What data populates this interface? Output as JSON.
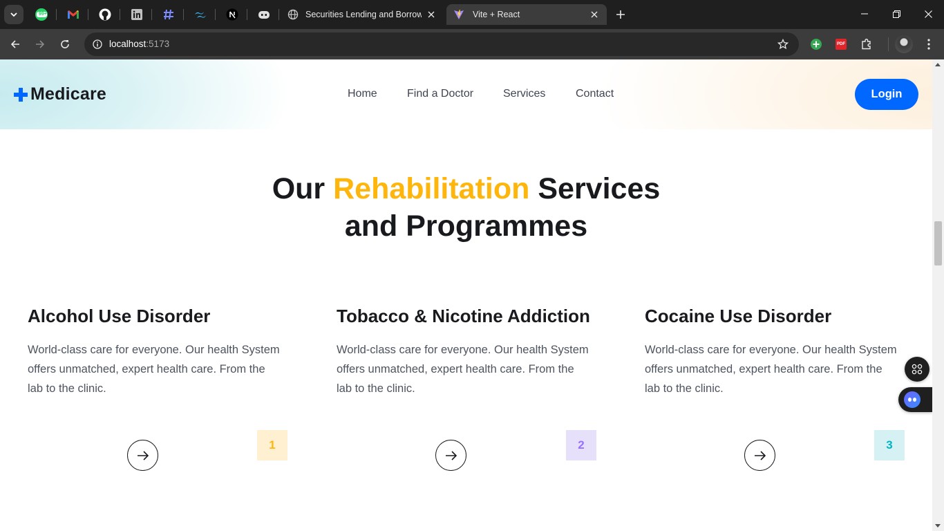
{
  "browser": {
    "tabs": [
      {
        "title": "Securities Lending and Borrowing",
        "active": false
      },
      {
        "title": "Vite + React",
        "active": true
      }
    ],
    "pinned_badge": "99+",
    "pinned_tabs": [
      "whatsapp-icon",
      "gmail-icon",
      "github-icon",
      "linkedin-icon",
      "hashnode-icon",
      "tailwind-icon",
      "nextjs-icon",
      "copilot-icon"
    ],
    "url_host": "localhost",
    "url_port": ":5173",
    "extensions": [
      "add-extension-icon",
      "pdf-extension-icon",
      "puzzle-icon",
      "profile-avatar",
      "menu-icon"
    ],
    "pdf_label": "PDF"
  },
  "site": {
    "logo": "Medicare",
    "nav": [
      "Home",
      "Find a Doctor",
      "Services",
      "Contact"
    ],
    "login": "Login",
    "heading": {
      "before": "Our ",
      "highlight": "Rehabilitation",
      "after_line1": " Services",
      "line2": "and Programmes"
    },
    "cards": [
      {
        "title": "Alcohol Use Disorder",
        "description": "World-class care for everyone. Our health System offers unmatched, expert health care. From the lab to the clinic.",
        "number": "1",
        "badge_bg": "#fef0d0",
        "badge_fg": "#feb60d"
      },
      {
        "title": "Tobacco & Nicotine Addiction",
        "description": "World-class care for everyone. Our health System offers unmatched, expert health care. From the lab to the clinic.",
        "number": "2",
        "badge_bg": "#e6e0fb",
        "badge_fg": "#9771ff"
      },
      {
        "title": "Cocaine Use Disorder",
        "description": "World-class care for everyone. Our health System offers unmatched, expert health care. From the lab to the clinic.",
        "number": "3",
        "badge_bg": "#d5f1f4",
        "badge_fg": "#01b5c5"
      }
    ]
  },
  "colors": {
    "primary": "#0067ff",
    "highlight": "#feb60d",
    "heading": "#181a1e",
    "text": "#4e545f"
  }
}
